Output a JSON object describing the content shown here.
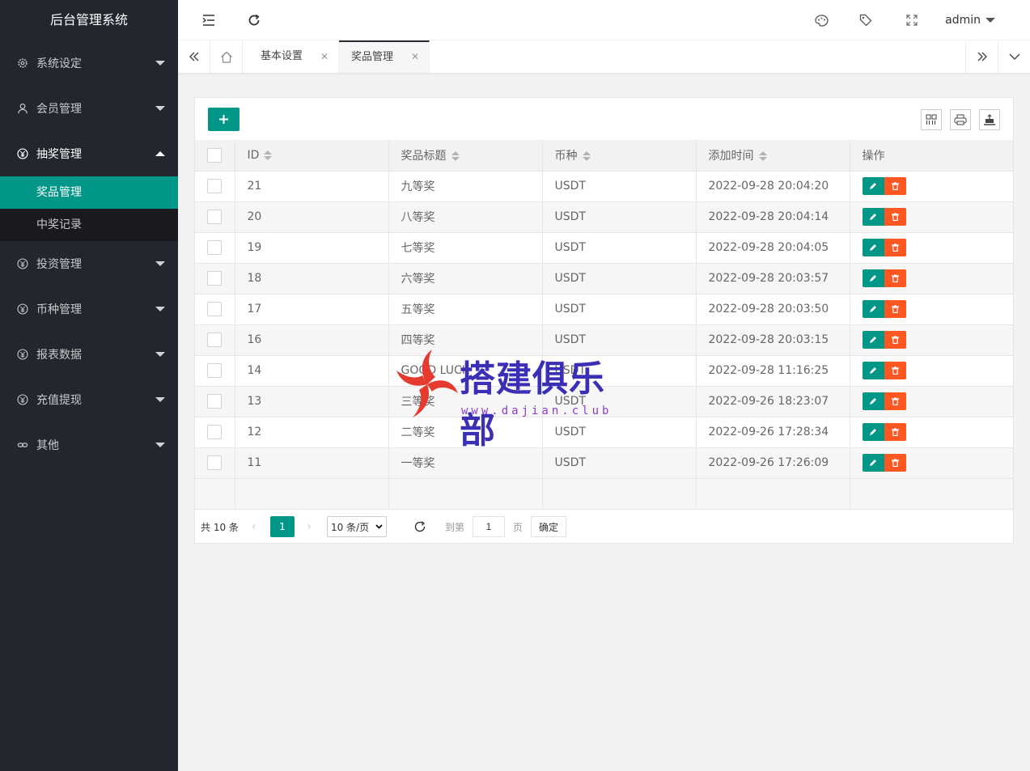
{
  "app": {
    "title": "后台管理系统"
  },
  "sidebar": {
    "items": [
      {
        "label": "系统设定",
        "icon": "gear-icon"
      },
      {
        "label": "会员管理",
        "icon": "user-icon"
      },
      {
        "label": "抽奖管理",
        "icon": "yen-icon",
        "open": true,
        "children": [
          {
            "label": "奖品管理",
            "active": true
          },
          {
            "label": "中奖记录"
          }
        ]
      },
      {
        "label": "投资管理",
        "icon": "yen-icon"
      },
      {
        "label": "币种管理",
        "icon": "yen-icon"
      },
      {
        "label": "报表数据",
        "icon": "yen-icon"
      },
      {
        "label": "充值提现",
        "icon": "yen-icon"
      },
      {
        "label": "其他",
        "icon": "link-icon"
      }
    ]
  },
  "header": {
    "user": "admin"
  },
  "tabs": [
    {
      "label": "基本设置"
    },
    {
      "label": "奖品管理",
      "active": true
    }
  ],
  "table": {
    "columns": [
      "ID",
      "奖品标题",
      "币种",
      "添加时间",
      "操作"
    ],
    "rows": [
      {
        "id": "21",
        "title": "九等奖",
        "coin": "USDT",
        "time": "2022-09-28 20:04:20"
      },
      {
        "id": "20",
        "title": "八等奖",
        "coin": "USDT",
        "time": "2022-09-28 20:04:14"
      },
      {
        "id": "19",
        "title": "七等奖",
        "coin": "USDT",
        "time": "2022-09-28 20:04:05"
      },
      {
        "id": "18",
        "title": "六等奖",
        "coin": "USDT",
        "time": "2022-09-28 20:03:57"
      },
      {
        "id": "17",
        "title": "五等奖",
        "coin": "USDT",
        "time": "2022-09-28 20:03:50"
      },
      {
        "id": "16",
        "title": "四等奖",
        "coin": "USDT",
        "time": "2022-09-28 20:03:15"
      },
      {
        "id": "14",
        "title": "GOOD LUCK",
        "coin": "USDT",
        "time": "2022-09-28 11:16:25"
      },
      {
        "id": "13",
        "title": "三等奖",
        "coin": "USDT",
        "time": "2022-09-26 18:23:07"
      },
      {
        "id": "12",
        "title": "二等奖",
        "coin": "USDT",
        "time": "2022-09-26 17:28:34"
      },
      {
        "id": "11",
        "title": "一等奖",
        "coin": "USDT",
        "time": "2022-09-26 17:26:09"
      }
    ]
  },
  "pager": {
    "total": "共 10 条",
    "current": "1",
    "per_page": "10 条/页",
    "goto_label": "到第",
    "goto_value": "1",
    "page_unit": "页",
    "confirm": "确定"
  },
  "watermark": {
    "title": "搭建俱乐部",
    "url": "www.dajian.club"
  },
  "colors": {
    "sidebar": "#23262e",
    "accent": "#009688",
    "danger": "#ff5722"
  }
}
